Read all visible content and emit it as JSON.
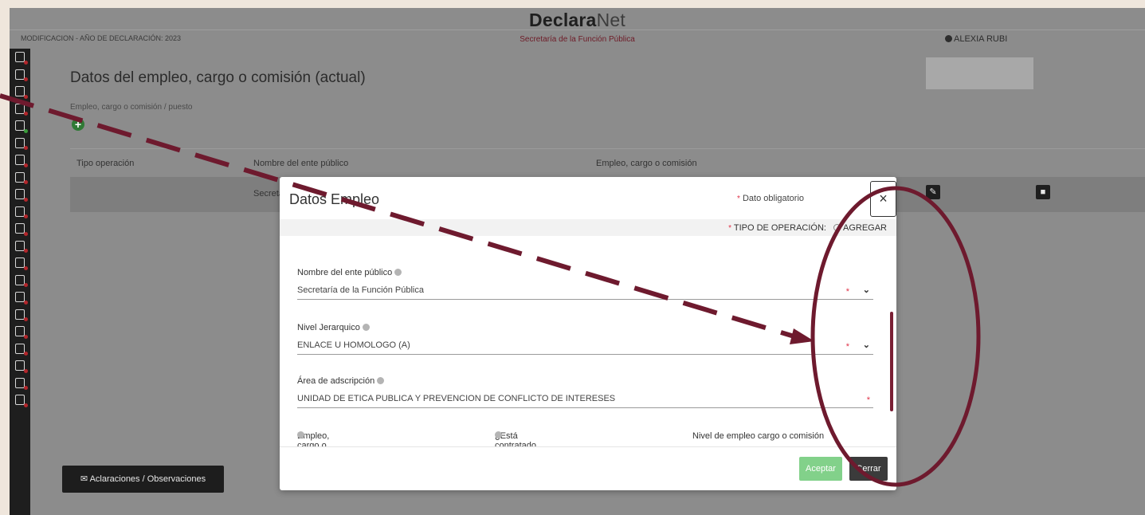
{
  "header": {
    "brand_bold": "Declara",
    "brand_rest": "Net",
    "subtitle": "Secretaría de la Función Pública",
    "mode": "MODIFICACION - AÑO DE DECLARACIÓN: 2023",
    "user": "ALEXIA RUBI"
  },
  "sidebar": {
    "items": [
      {
        "icon": "document-icon",
        "status": "incomplete"
      },
      {
        "icon": "home-upload-icon",
        "status": "incomplete"
      },
      {
        "icon": "file-icon",
        "status": "incomplete"
      },
      {
        "icon": "briefcase-file-icon",
        "status": "incomplete"
      },
      {
        "icon": "couple-icon",
        "status": "complete"
      },
      {
        "icon": "family-icon",
        "status": "incomplete"
      },
      {
        "icon": "ledger-icon",
        "status": "incomplete"
      },
      {
        "icon": "search-user-icon",
        "status": "incomplete"
      },
      {
        "icon": "house-icon",
        "status": "incomplete"
      },
      {
        "icon": "car-icon",
        "status": "incomplete"
      },
      {
        "icon": "chart-icon",
        "status": "incomplete"
      },
      {
        "icon": "hands-icon",
        "status": "incomplete"
      },
      {
        "icon": "bank-icon",
        "status": "incomplete"
      },
      {
        "icon": "house-money-icon",
        "status": "incomplete"
      },
      {
        "icon": "pie-icon",
        "status": "incomplete"
      },
      {
        "icon": "network-icon",
        "status": "incomplete"
      },
      {
        "icon": "globe-people-icon",
        "status": "incomplete"
      },
      {
        "icon": "organization-icon",
        "status": "incomplete"
      },
      {
        "icon": "chart-people-icon",
        "status": "incomplete"
      },
      {
        "icon": "group-icon",
        "status": "incomplete"
      },
      {
        "icon": "calculator-icon",
        "status": "incomplete"
      }
    ],
    "colors": {
      "incomplete": "#b3262b",
      "complete": "#3a9b3a"
    }
  },
  "main": {
    "title": "Datos del empleo, cargo o comisión (actual)",
    "section_label": "Empleo, cargo o comisión / puesto",
    "add_symbol": "+",
    "table": {
      "headers": [
        "Tipo operación",
        "Nombre del ente público",
        "Empleo, cargo o comisión"
      ],
      "row": {
        "ente": "Secretaría de la Función Pública"
      },
      "edit_icon": "edit-icon",
      "delete_icon": "trash-icon"
    },
    "aclaraciones_button": "Aclaraciones / Observaciones"
  },
  "modal": {
    "title": "Datos Empleo",
    "required_note": "Dato obligatorio",
    "required_mark": "*",
    "close_symbol": "×",
    "operation_label": "TIPO DE OPERACIÓN:",
    "operation_option": "AGREGAR",
    "fields": {
      "ente": {
        "label": "Nombre del ente público",
        "value": "Secretaría de la Función Pública"
      },
      "nivel": {
        "label": "Nivel Jerarquico",
        "value": "ENLACE U HOMOLOGO (A)"
      },
      "area": {
        "label": "Área de adscripción",
        "value": "UNIDAD DE ETICA PUBLICA Y PREVENCION DE CONFLICTO DE INTERESES"
      }
    },
    "bottom_labels": {
      "empleo": "Empleo, cargo o comisión",
      "honorarios": "¿Está contratado por honorarios?",
      "nivel_empleo": "Nivel de empleo cargo o comisión"
    },
    "accept": "Aceptar",
    "cancel": "Cerrar"
  },
  "annotation": {
    "color": "#6e1a2e"
  }
}
